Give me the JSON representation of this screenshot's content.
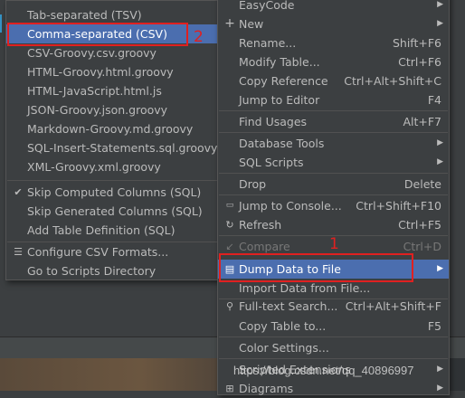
{
  "submenu": {
    "items": [
      {
        "label": "Tab-separated (TSV)"
      },
      {
        "label": "Comma-separated (CSV)"
      },
      {
        "label": "CSV-Groovy.csv.groovy"
      },
      {
        "label": "HTML-Groovy.html.groovy"
      },
      {
        "label": "HTML-JavaScript.html.js"
      },
      {
        "label": "JSON-Groovy.json.groovy"
      },
      {
        "label": "Markdown-Groovy.md.groovy"
      },
      {
        "label": "SQL-Insert-Statements.sql.groovy"
      },
      {
        "label": "XML-Groovy.xml.groovy"
      },
      {
        "label": "Skip Computed Columns (SQL)",
        "checked": true
      },
      {
        "label": "Skip Generated Columns (SQL)"
      },
      {
        "label": "Add Table Definition (SQL)"
      },
      {
        "label": "Configure CSV Formats..."
      },
      {
        "label": "Go to Scripts Directory"
      }
    ]
  },
  "mainmenu": {
    "items": [
      {
        "label": "EasyCode",
        "submenu": true
      },
      {
        "label": "New",
        "submenu": true,
        "icon": "plus-icon"
      },
      {
        "label": "Rename...",
        "shortcut": "Shift+F6"
      },
      {
        "label": "Modify Table...",
        "shortcut": "Ctrl+F6"
      },
      {
        "label": "Copy Reference",
        "shortcut": "Ctrl+Alt+Shift+C"
      },
      {
        "label": "Jump to Editor",
        "shortcut": "F4"
      },
      {
        "label": "Find Usages",
        "shortcut": "Alt+F7"
      },
      {
        "label": "Database Tools",
        "submenu": true
      },
      {
        "label": "SQL Scripts",
        "submenu": true
      },
      {
        "label": "Drop",
        "shortcut": "Delete"
      },
      {
        "label": "Jump to Console...",
        "shortcut": "Ctrl+Shift+F10"
      },
      {
        "label": "Refresh",
        "shortcut": "Ctrl+F5"
      },
      {
        "label": "Compare",
        "shortcut": "Ctrl+D"
      },
      {
        "label": "Dump Data to File",
        "submenu": true
      },
      {
        "label": "Import Data from File..."
      },
      {
        "label": "Full-text Search...",
        "shortcut": "Ctrl+Alt+Shift+F"
      },
      {
        "label": "Copy Table to...",
        "shortcut": "F5"
      },
      {
        "label": "Color Settings..."
      },
      {
        "label": "Scripted Extensions",
        "submenu": true
      },
      {
        "label": "Diagrams",
        "submenu": true
      }
    ]
  },
  "annotations": {
    "step1": "1",
    "step2": "2"
  },
  "watermark": "https://blog.csdn.net/qq_40896997",
  "colors": {
    "highlight": "#4b6eaf",
    "annotation": "#e02020",
    "menu_bg": "#3c3f41"
  }
}
